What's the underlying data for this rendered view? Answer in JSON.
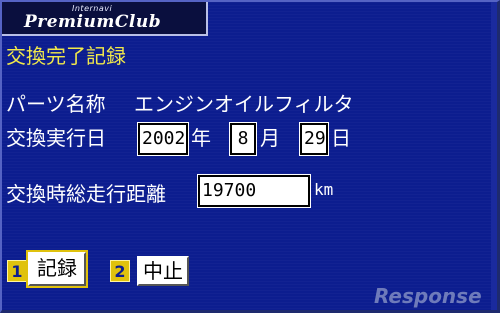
{
  "header": {
    "logo_small": "Internavi",
    "logo_main": "PremiumClub"
  },
  "page": {
    "title": "交換完了記録"
  },
  "form": {
    "parts_label": "パーツ名称",
    "parts_value": "エンジンオイルフィルタ",
    "date_label": "交換実行日",
    "year_value": "2002",
    "year_unit": "年",
    "month_value": "8",
    "month_unit": "月",
    "day_value": "29",
    "day_unit": "日",
    "distance_label": "交換時総走行距離",
    "distance_value": "19700",
    "distance_unit": "km"
  },
  "actions": {
    "record_key": "1",
    "record_label": "記録",
    "cancel_key": "2",
    "cancel_label": "中止"
  },
  "watermark": "Response",
  "colors": {
    "background": "#0c1d8f",
    "title": "#f2e94a",
    "key_badge": "#e0c20d"
  }
}
